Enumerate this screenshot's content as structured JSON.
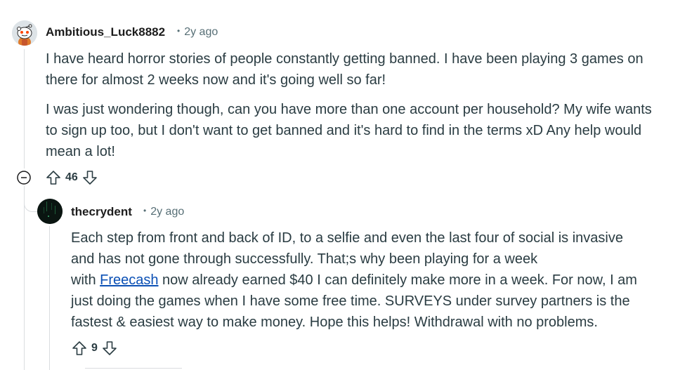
{
  "comments": [
    {
      "author": "Ambitious_Luck8882",
      "age": "2y ago",
      "paragraphs": [
        "I have heard horror stories of people constantly getting banned. I have been playing 3 games on there for almost 2 weeks now and it's going well so far!",
        "I was just wondering though, can you have more than one account per household? My wife wants to sign up too, but I don't want to get banned and it's hard to find in the terms xD Any help would mean a lot!"
      ],
      "score": "46",
      "avatar_icon": "snoo-avatar-icon"
    },
    {
      "author": "thecrydent",
      "age": "2y ago",
      "line1": "Each step from front and back of ID, to a selfie and even the last four of social is invasive",
      "line2": "and has not gone through successfully. That;s why been playing for a week",
      "line3_prefix": "with ",
      "link_text": "Freecash",
      "line3_suffix": " now already earned $40 I can definitely make more in a week. For now, I am",
      "line4": "just doing the games when I have some free time. SURVEYS under survey partners is the",
      "line5": "fastest & easiest way to make money. Hope this helps! Withdrawal with no problems.",
      "score": "9",
      "avatar_icon": "dark-avatar-icon"
    }
  ],
  "icons": {
    "upvote": "upvote-arrow-icon",
    "downvote": "downvote-arrow-icon",
    "collapse": "collapse-minus-icon"
  },
  "colors": {
    "link": "#0b50b5",
    "meta": "#576f76",
    "body_text": "#2a3c42",
    "thread_line": "#dadde0"
  }
}
